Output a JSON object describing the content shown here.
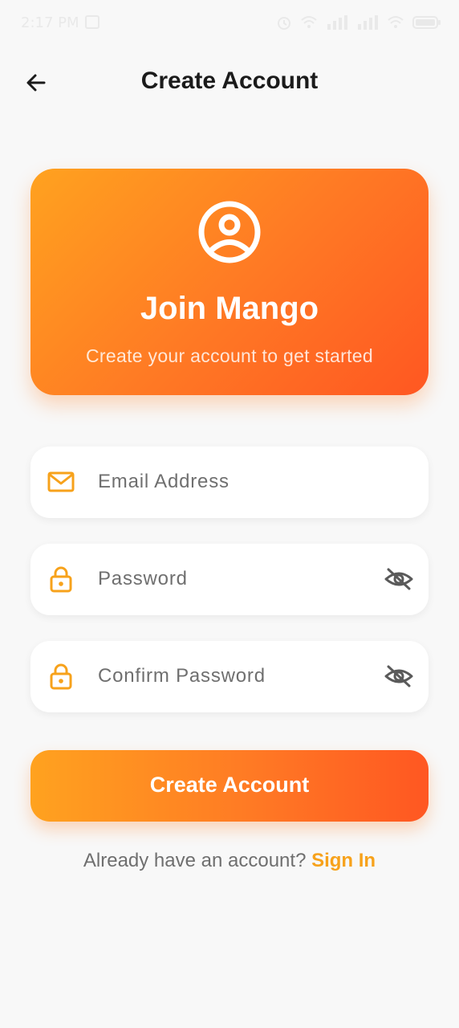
{
  "status_bar": {
    "time": "2:17 PM",
    "app_icon": "linkedin-icon",
    "icons": [
      "alarm-icon",
      "wifi-icon",
      "signal-icon",
      "signal-icon",
      "wifi-icon",
      "battery-icon"
    ],
    "text_color": "#e9e9e9"
  },
  "header": {
    "title": "Create Account",
    "back_icon": "arrow-left-icon"
  },
  "hero": {
    "icon": "user-circle-icon",
    "title": "Join Mango",
    "subtitle": "Create your account to get started",
    "gradient": [
      "#ffa21f",
      "#ff7a24",
      "#ff5722"
    ]
  },
  "form": {
    "email": {
      "placeholder": "Email Address",
      "icon": "mail-icon"
    },
    "password": {
      "placeholder": "Password",
      "icon": "lock-icon",
      "toggle_icon": "eye-off-icon"
    },
    "confirm_password": {
      "placeholder": "Confirm Password",
      "icon": "lock-icon",
      "toggle_icon": "eye-off-icon"
    },
    "icon_color": "#f7a21b"
  },
  "submit": {
    "label": "Create Account"
  },
  "footer": {
    "prompt": "Already have an account?",
    "link": "Sign In",
    "link_color": "#f7a21b"
  }
}
